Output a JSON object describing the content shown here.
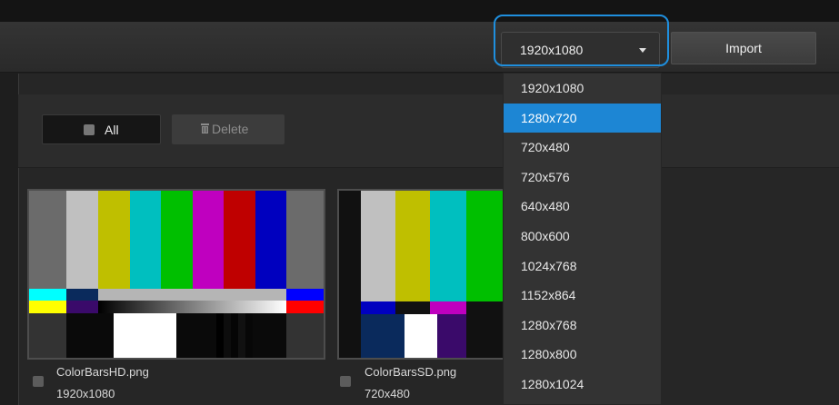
{
  "toolbar": {
    "resolution_selected": "1920x1080",
    "import_label": "Import"
  },
  "resolution_menu": {
    "options": [
      "1920x1080",
      "1280x720",
      "720x480",
      "720x576",
      "640x480",
      "800x600",
      "1024x768",
      "1152x864",
      "1280x768",
      "1280x800",
      "1280x1024"
    ],
    "highlighted": "1280x720"
  },
  "actions": {
    "all_label": "All",
    "delete_label": "Delete"
  },
  "thumbnails": [
    {
      "name": "ColorBarsHD.png",
      "resolution": "1920x1080"
    },
    {
      "name": "ColorBarsSD.png",
      "resolution": "720x480"
    }
  ],
  "colors": {
    "accent": "#1d86d4",
    "focus_ring": "#1f8fde"
  }
}
